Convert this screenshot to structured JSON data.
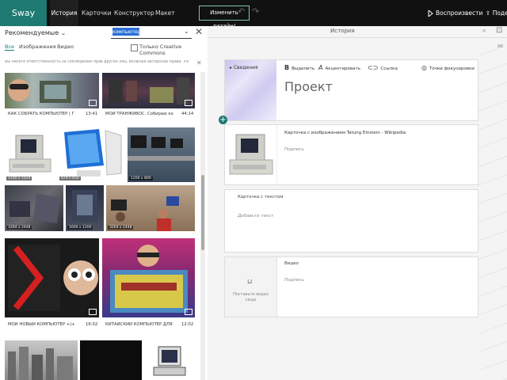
{
  "app": {
    "brand": "Sway",
    "tabs": [
      {
        "label": "История",
        "active": true
      },
      {
        "label": "Карточки",
        "active": false
      },
      {
        "label": "Конструктор",
        "active": false
      },
      {
        "label": "Макет",
        "active": false
      }
    ],
    "design_button": "Изменить дизайн!",
    "play_label": "Воспроизвести",
    "share_label": "Поде",
    "accent_color": "#1e7a72"
  },
  "left_panel": {
    "source_label": "Рекомендуемые",
    "search_value": "компьютер",
    "filters": [
      {
        "label": "Все",
        "active": true
      },
      {
        "label": "Изображения",
        "active": false
      },
      {
        "label": "Видео",
        "active": false
      }
    ],
    "cc_label": "Только Creative Commons",
    "notice": "Вы несете ответственность за соблюдение прав других лиц, включая авторские права. Узнайте об этом подробнее.",
    "results": [
      {
        "kind": "video",
        "caption": "КАК СОБРАТЬ КОМПЬЮТЕР | Гайд...",
        "duration": "13:41"
      },
      {
        "kind": "video",
        "caption": "МОЙ ТРАНЖИВОС. Собираю ком...",
        "duration": "44:14"
      },
      {
        "kind": "image",
        "size": "1200 x 1024"
      },
      {
        "kind": "image",
        "size": "879 x 650"
      },
      {
        "kind": "image",
        "size": "1200 x 800"
      },
      {
        "kind": "image",
        "size": "3264 x 2448"
      },
      {
        "kind": "image",
        "size": "1600 x 1200"
      },
      {
        "kind": "image",
        "size": "3264 x 2448"
      },
      {
        "kind": "video",
        "caption": "МОЙ НОВЫЙ КОМПЬЮТЕР +|+ ...",
        "duration": "16:02"
      },
      {
        "kind": "video",
        "caption": "КИТАЙСКИЙ КОМПЬЮТЕР ДЛЯ ...",
        "duration": "12:02"
      }
    ]
  },
  "storyline": {
    "title": "История",
    "title_card": {
      "background_label": "Сведения",
      "toolbar": [
        "Выделить",
        "Акцентировать",
        "Ссылка",
        "Точки фокусировки"
      ],
      "heading": "Проект"
    },
    "image_card": {
      "text": "Карточка с изображением Tatung Einstein - Wikipedia",
      "caption_placeholder": "Подпись"
    },
    "text_card": {
      "label": "Карточка с текстом",
      "placeholder": "Добавьте текст"
    },
    "video_card": {
      "label": "Видео",
      "caption_placeholder": "Подпись",
      "empty_text": "Поставьте видео сюда"
    }
  }
}
